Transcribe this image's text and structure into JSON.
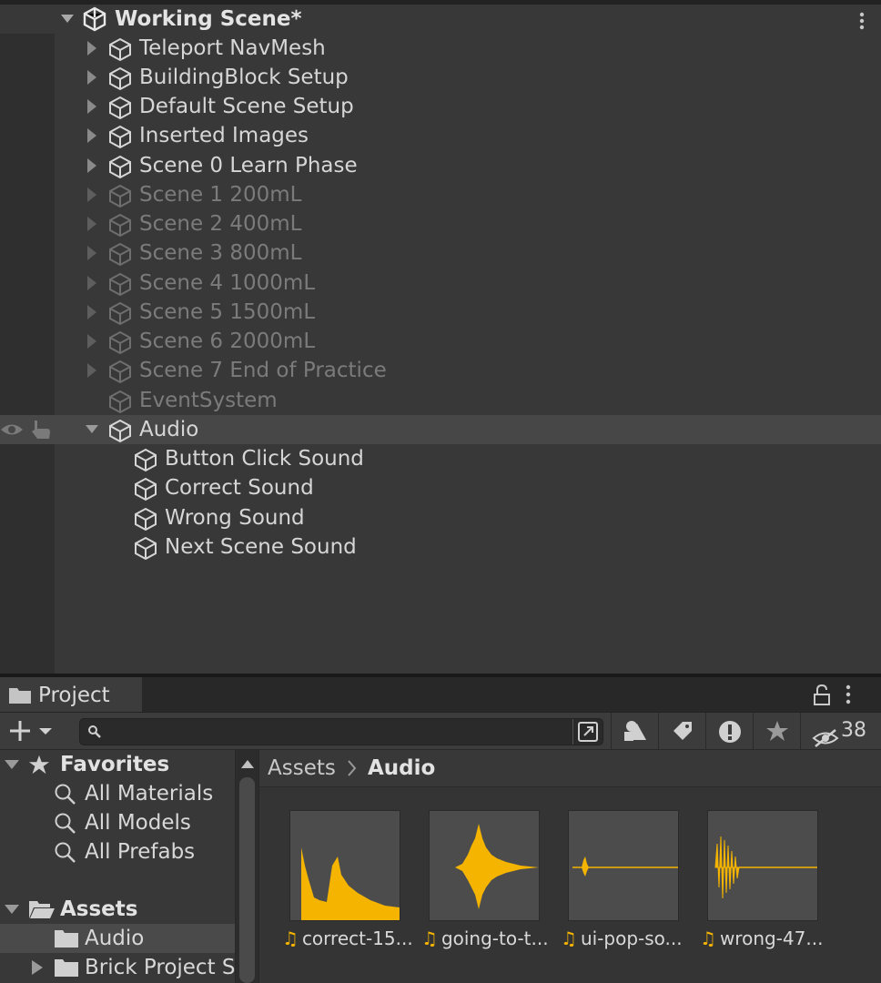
{
  "hierarchy": {
    "scene_name": "Working Scene*",
    "items": [
      {
        "label": "Teleport NavMesh",
        "dim": false
      },
      {
        "label": "BuildingBlock Setup",
        "dim": false
      },
      {
        "label": "Default Scene Setup",
        "dim": false
      },
      {
        "label": "Inserted Images",
        "dim": false
      },
      {
        "label": "Scene 0 Learn Phase",
        "dim": false
      },
      {
        "label": "Scene 1 200mL",
        "dim": true
      },
      {
        "label": "Scene 2 400mL",
        "dim": true
      },
      {
        "label": "Scene 3 800mL",
        "dim": true
      },
      {
        "label": "Scene 4 1000mL",
        "dim": true
      },
      {
        "label": "Scene 5 1500mL",
        "dim": true
      },
      {
        "label": "Scene 6 2000mL",
        "dim": true
      },
      {
        "label": "Scene 7 End of Practice",
        "dim": true
      },
      {
        "label": "EventSystem",
        "dim": true
      },
      {
        "label": "Audio",
        "dim": false
      }
    ],
    "audio_children": [
      "Button Click Sound",
      "Correct Sound",
      "Wrong Sound",
      "Next Scene Sound"
    ]
  },
  "project": {
    "tab_label": "Project",
    "search_placeholder": "",
    "hidden_count": "38",
    "favorites_label": "Favorites",
    "favorites": [
      "All Materials",
      "All Models",
      "All Prefabs"
    ],
    "assets_label": "Assets",
    "asset_folders": [
      "Audio",
      "Brick Project S"
    ],
    "breadcrumb": {
      "root": "Assets",
      "current": "Audio"
    },
    "files": [
      "correct-15...",
      "going-to-t...",
      "ui-pop-so...",
      "wrong-47..."
    ]
  },
  "colors": {
    "accent_note": "#f4b400",
    "selected_row": "#4a4a4a",
    "waveform": "#f4b400"
  }
}
